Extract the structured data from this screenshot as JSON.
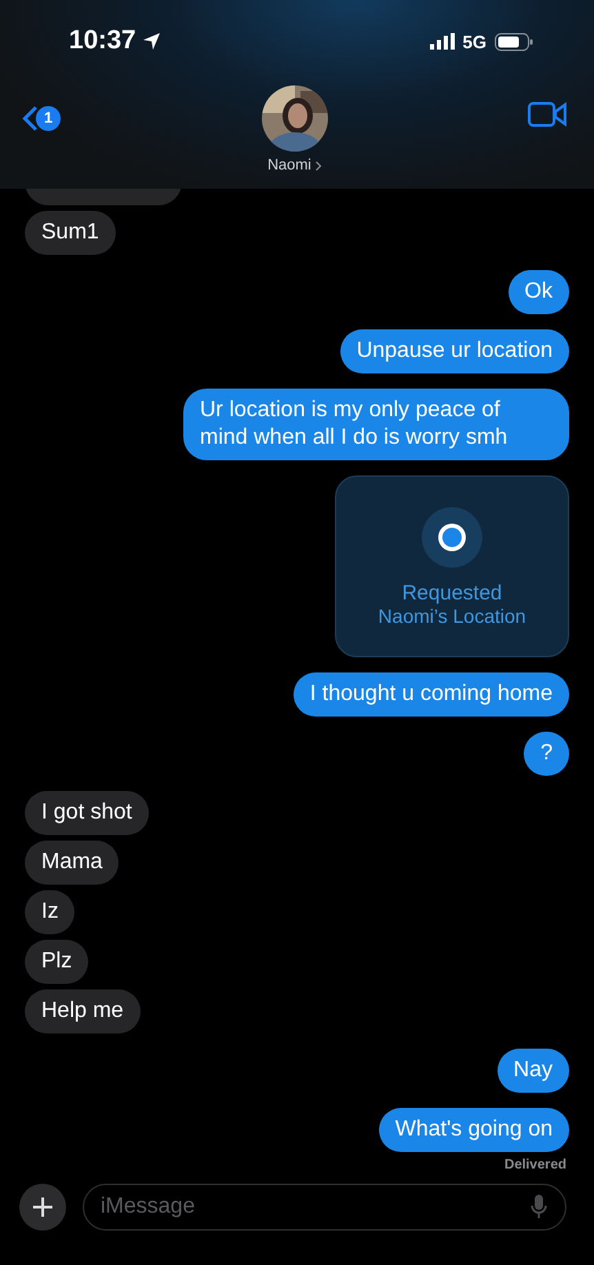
{
  "status_bar": {
    "time": "10:37",
    "network": "5G"
  },
  "header": {
    "back_badge": "1",
    "contact_name": "Naomi"
  },
  "messages": [
    {
      "kind": "partial",
      "outgoing": false
    },
    {
      "kind": "text",
      "outgoing": false,
      "text": "Sum1"
    },
    {
      "kind": "text",
      "outgoing": true,
      "text": "Ok"
    },
    {
      "kind": "text",
      "outgoing": true,
      "text": "Unpause ur location"
    },
    {
      "kind": "text",
      "outgoing": true,
      "text": "Ur location is my only peace of mind when all I do is worry smh"
    },
    {
      "kind": "location",
      "outgoing": true,
      "title": "Requested",
      "subtitle": "Naomi’s Location"
    },
    {
      "kind": "text",
      "outgoing": true,
      "text": "I thought u coming home"
    },
    {
      "kind": "text",
      "outgoing": true,
      "text": "?"
    },
    {
      "kind": "text",
      "outgoing": false,
      "text": "I got shot"
    },
    {
      "kind": "text",
      "outgoing": false,
      "text": "Mama"
    },
    {
      "kind": "text",
      "outgoing": false,
      "text": "Iz"
    },
    {
      "kind": "text",
      "outgoing": false,
      "text": "Plz"
    },
    {
      "kind": "text",
      "outgoing": false,
      "text": "Help me"
    },
    {
      "kind": "text",
      "outgoing": true,
      "text": "Nay"
    },
    {
      "kind": "text",
      "outgoing": true,
      "text": "What's going on"
    }
  ],
  "delivery_status": "Delivered",
  "composer": {
    "placeholder": "iMessage"
  }
}
